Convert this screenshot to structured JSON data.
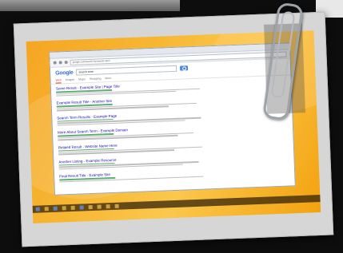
{
  "browser": {
    "address": "google.com/search?q=search+term",
    "logo": "Google",
    "query": "search term",
    "tabs": [
      "Web",
      "Images",
      "Maps",
      "Shopping",
      "More"
    ]
  },
  "results": [
    {
      "title": "Some Result - Example Site | Page Title"
    },
    {
      "title": "Example Result Title - Another Site"
    },
    {
      "title": "Search Term Results - Example Page"
    },
    {
      "title": "More About Search Term - Example Domain"
    },
    {
      "title": "Related Result - Website Name Here"
    },
    {
      "title": "Another Listing - Example Resource"
    },
    {
      "title": "Final Result Title - Example Site"
    }
  ],
  "colors": {
    "desktop": "#f5a623",
    "link": "#1a0dab",
    "accent": "#4a87e8"
  }
}
